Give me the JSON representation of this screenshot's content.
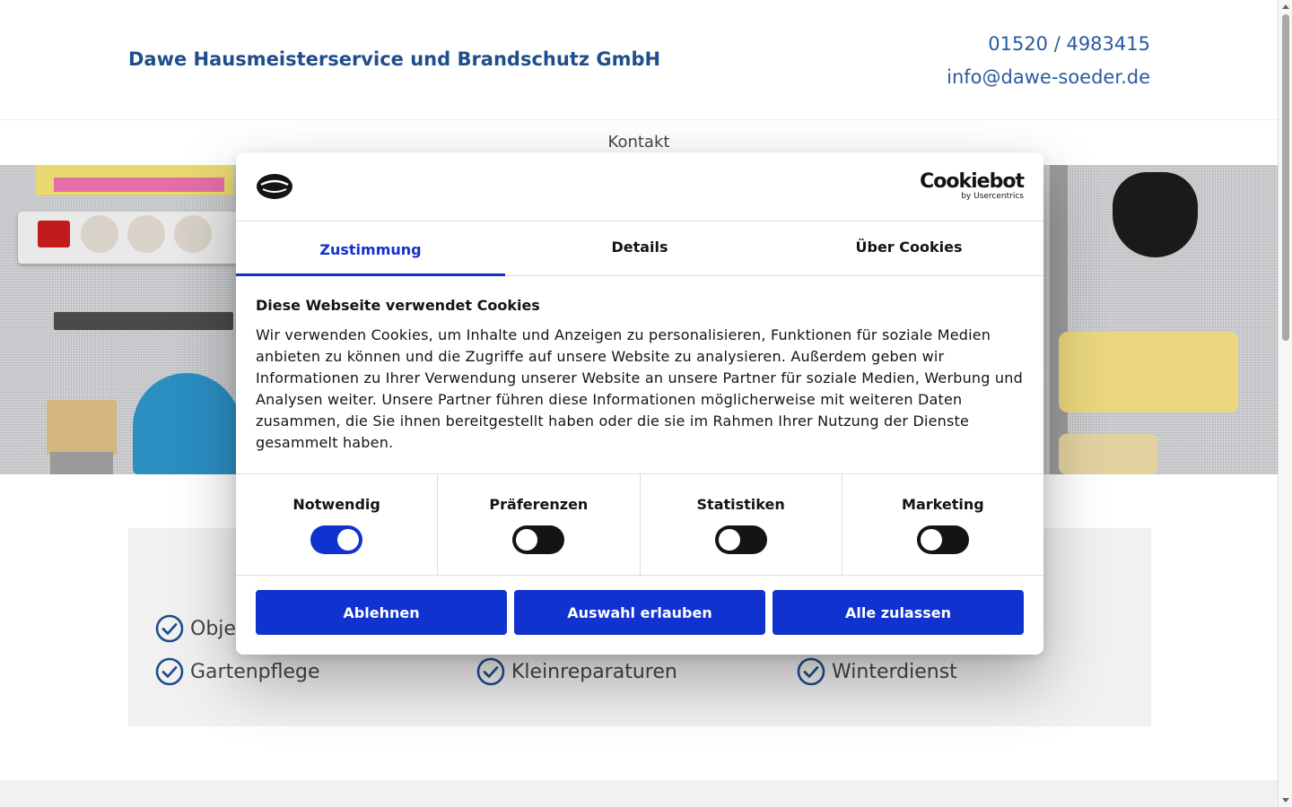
{
  "header": {
    "brand": "Dawe Hausmeisterservice und Brandschutz GmbH",
    "phone": "01520 / 4983415",
    "email": "info@dawe-soeder.de"
  },
  "nav": {
    "items": [
      {
        "label": "Kontakt"
      }
    ]
  },
  "services": {
    "items": [
      {
        "label": "Objek"
      },
      {
        "label": "Gartenpflege"
      },
      {
        "label": "Kleinreparaturen"
      },
      {
        "label": "Winterdienst"
      }
    ]
  },
  "cookie_dialog": {
    "brand_name": "Cookiebot",
    "brand_sub": "by Usercentrics",
    "tabs": [
      {
        "label": "Zustimmung",
        "active": true
      },
      {
        "label": "Details",
        "active": false
      },
      {
        "label": "Über Cookies",
        "active": false
      }
    ],
    "heading": "Diese Webseite verwendet Cookies",
    "text": "Wir verwenden Cookies, um Inhalte und Anzeigen zu personalisieren, Funktionen für soziale Medien anbieten zu können und die Zugriffe auf unsere Website zu analysieren. Außerdem geben wir Informationen zu Ihrer Verwendung unserer Website an unsere Partner für soziale Medien, Werbung und Analysen weiter. Unsere Partner führen diese Informationen möglicherweise mit weiteren Daten zusammen, die Sie ihnen bereitgestellt haben oder die sie im Rahmen Ihrer Nutzung der Dienste gesammelt haben.",
    "toggles": [
      {
        "label": "Notwendig",
        "checked": true
      },
      {
        "label": "Präferenzen",
        "checked": false
      },
      {
        "label": "Statistiken",
        "checked": false
      },
      {
        "label": "Marketing",
        "checked": false
      }
    ],
    "buttons": {
      "decline": "Ablehnen",
      "allow_selection": "Auswahl erlauben",
      "allow_all": "Alle zulassen"
    }
  },
  "colors": {
    "brand_blue": "#1f4e8c",
    "cookie_accent": "#1032cf",
    "toggle_off": "#141414"
  },
  "icons": [
    "check-circle-icon",
    "cookiebot-logo-icon"
  ]
}
